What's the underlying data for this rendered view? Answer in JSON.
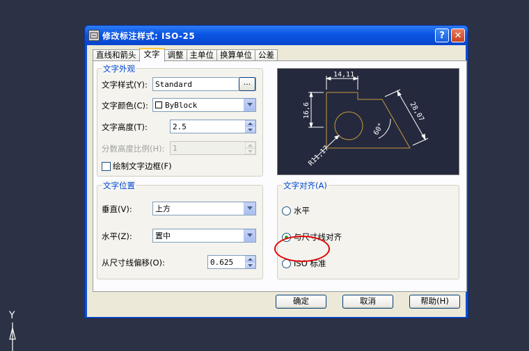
{
  "window": {
    "title": "修改标注样式: ISO-25",
    "help_label": "?",
    "close_label": "✕"
  },
  "tabs": [
    {
      "label": "直线和箭头",
      "active": false
    },
    {
      "label": "文字",
      "active": true
    },
    {
      "label": "调整",
      "active": false
    },
    {
      "label": "主单位",
      "active": false
    },
    {
      "label": "换算单位",
      "active": false
    },
    {
      "label": "公差",
      "active": false
    }
  ],
  "appearance": {
    "title": "文字外观",
    "style_label": "文字样式(Y):",
    "style_value": "Standard",
    "browse_label": "...",
    "color_label": "文字颜色(C):",
    "color_value": "ByBlock",
    "height_label": "文字高度(T):",
    "height_value": "2.5",
    "fraction_label": "分数高度比例(H):",
    "fraction_value": "1",
    "frame_label": "绘制文字边框(F)",
    "frame_checked": false
  },
  "placement": {
    "title": "文字位置",
    "vertical_label": "垂直(V):",
    "vertical_value": "上方",
    "horizontal_label": "水平(Z):",
    "horizontal_value": "置中",
    "offset_label": "从尺寸线偏移(O):",
    "offset_value": "0.625"
  },
  "alignment": {
    "title": "文字对齐(A)",
    "options": [
      {
        "label": "水平",
        "selected": false
      },
      {
        "label": "与尺寸线对齐",
        "selected": true
      },
      {
        "label": "ISO 标准",
        "selected": false
      }
    ]
  },
  "preview": {
    "dim_top": "14,11",
    "dim_left": "16,6",
    "dim_right": "28,07",
    "dim_angle": "60°",
    "dim_radius": "R11,17",
    "geometry_color": "#c89a3c",
    "dim_color": "#ffffff"
  },
  "buttons": {
    "ok": "确定",
    "cancel": "取消",
    "help": "帮助(H)"
  },
  "ucs": {
    "axis_label": "Y"
  }
}
